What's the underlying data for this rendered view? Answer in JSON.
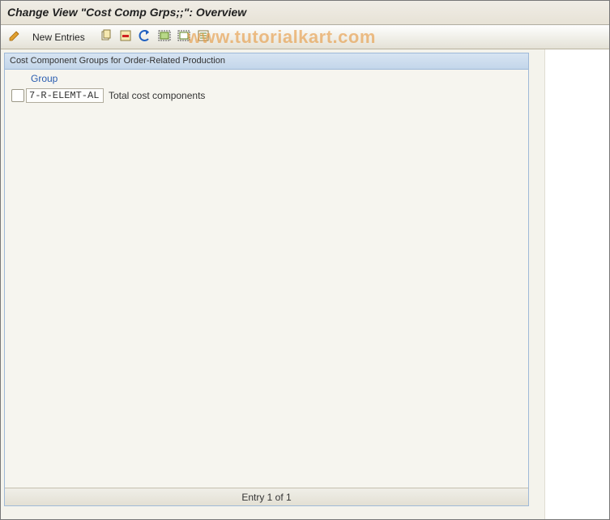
{
  "title": "Change View \"Cost Comp Grps;;\": Overview",
  "toolbar": {
    "new_entries": "New Entries"
  },
  "watermark": "www.tutorialkart.com",
  "panel": {
    "header": "Cost Component Groups for Order-Related Production",
    "column_header": "Group",
    "rows": [
      {
        "code": "7-R-ELEMT-AL",
        "desc": "Total cost components"
      }
    ]
  },
  "pagination": "Entry 1 of 1"
}
